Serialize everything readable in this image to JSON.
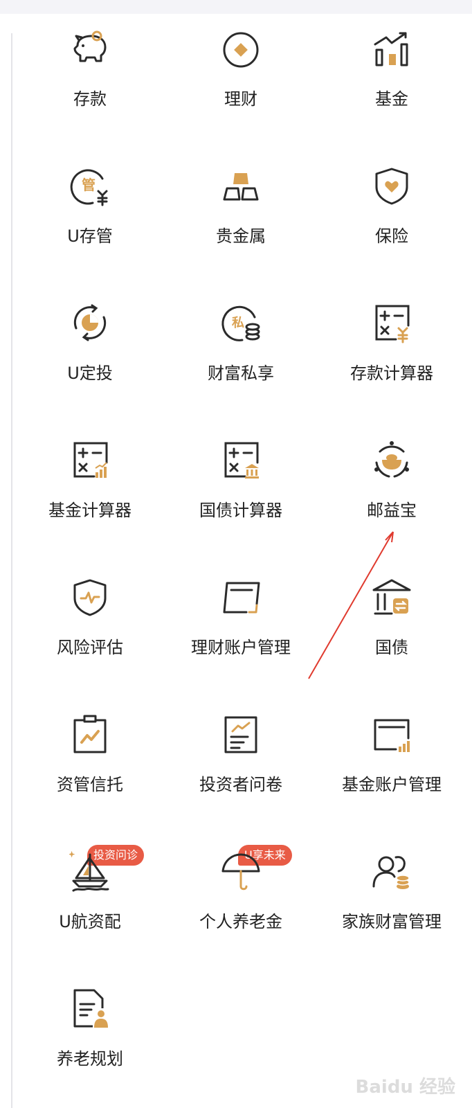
{
  "colors": {
    "accent": "#d9a152",
    "stroke": "#2b2b2b",
    "badge": "#e85b45",
    "text": "#222222"
  },
  "items": [
    {
      "label": "存款",
      "icon": "piggy-bank-icon"
    },
    {
      "label": "理财",
      "icon": "coin-icon"
    },
    {
      "label": "基金",
      "icon": "chart-growth-icon"
    },
    {
      "label": "U存管",
      "icon": "custody-icon"
    },
    {
      "label": "贵金属",
      "icon": "gold-bars-icon"
    },
    {
      "label": "保险",
      "icon": "shield-heart-icon"
    },
    {
      "label": "U定投",
      "icon": "auto-invest-icon"
    },
    {
      "label": "财富私享",
      "icon": "private-wealth-icon"
    },
    {
      "label": "存款计算器",
      "icon": "calculator-yuan-icon"
    },
    {
      "label": "基金计算器",
      "icon": "calculator-chart-icon"
    },
    {
      "label": "国债计算器",
      "icon": "calculator-bank-icon"
    },
    {
      "label": "邮益宝",
      "icon": "ingot-cycle-icon"
    },
    {
      "label": "风险评估",
      "icon": "shield-pulse-icon"
    },
    {
      "label": "理财账户管理",
      "icon": "card-account-icon"
    },
    {
      "label": "国债",
      "icon": "bank-building-icon"
    },
    {
      "label": "资管信托",
      "icon": "clipboard-trend-icon"
    },
    {
      "label": "投资者问卷",
      "icon": "survey-icon"
    },
    {
      "label": "基金账户管理",
      "icon": "card-chart-icon"
    },
    {
      "label": "U航资配",
      "icon": "sailboat-icon",
      "badge": "投资问诊"
    },
    {
      "label": "个人养老金",
      "icon": "umbrella-icon",
      "badge": "U享未来"
    },
    {
      "label": "家族财富管理",
      "icon": "family-wealth-icon"
    },
    {
      "label": "养老规划",
      "icon": "document-person-icon"
    }
  ],
  "watermark": "Baidu 经验"
}
